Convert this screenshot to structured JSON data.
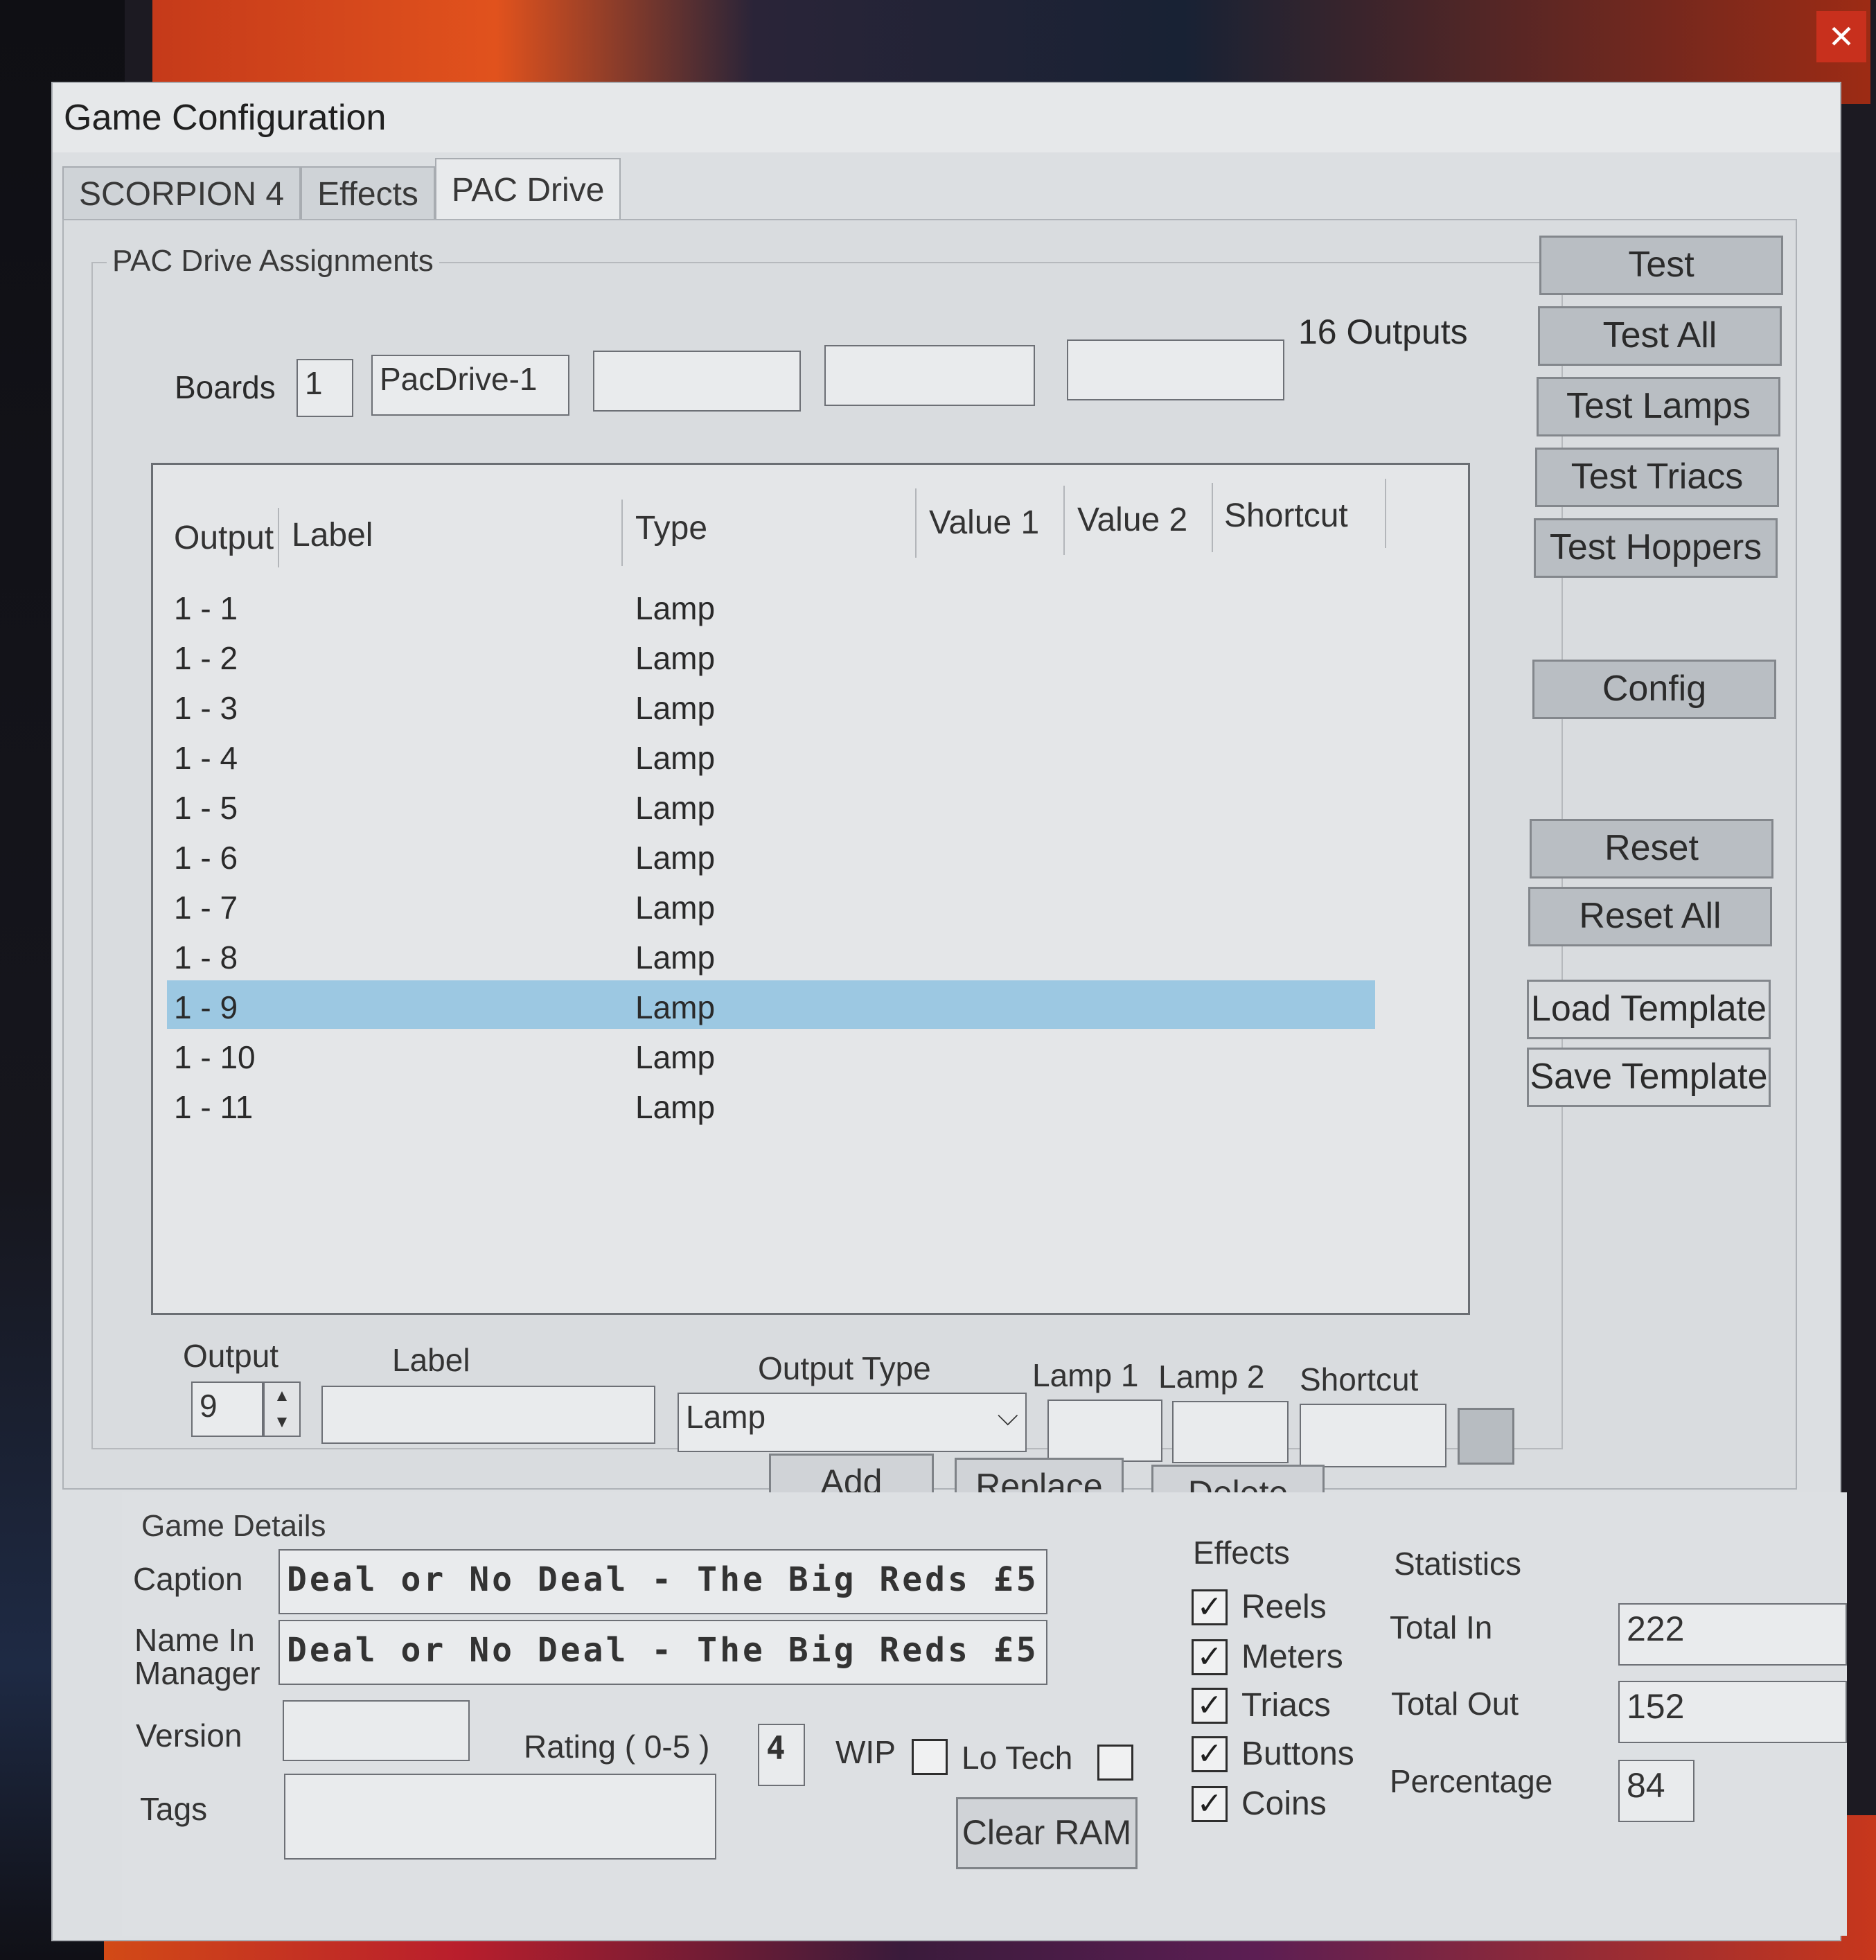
{
  "window": {
    "title": "Game Configuration",
    "close_glyph": "✕"
  },
  "tabs": [
    {
      "label": "SCORPION 4",
      "active": false
    },
    {
      "label": "Effects",
      "active": false
    },
    {
      "label": "PAC Drive",
      "active": true
    }
  ],
  "pac": {
    "group_label": "PAC Drive Assignments",
    "boards_label": "Boards",
    "boards_value": "1",
    "board_fields": [
      "PacDrive-1",
      "",
      "",
      ""
    ],
    "outputs_label": "16 Outputs",
    "columns": [
      "Output",
      "Label",
      "Type",
      "Value 1",
      "Value 2",
      "Shortcut"
    ],
    "rows": [
      {
        "output": "1 - 1",
        "label": "",
        "type": "Lamp"
      },
      {
        "output": "1 - 2",
        "label": "",
        "type": "Lamp"
      },
      {
        "output": "1 - 3",
        "label": "",
        "type": "Lamp"
      },
      {
        "output": "1 - 4",
        "label": "",
        "type": "Lamp"
      },
      {
        "output": "1 - 5",
        "label": "",
        "type": "Lamp"
      },
      {
        "output": "1 - 6",
        "label": "",
        "type": "Lamp"
      },
      {
        "output": "1 - 7",
        "label": "",
        "type": "Lamp"
      },
      {
        "output": "1 - 8",
        "label": "",
        "type": "Lamp"
      },
      {
        "output": "1 - 9",
        "label": "",
        "type": "Lamp",
        "selected": true
      },
      {
        "output": "1 - 10",
        "label": "",
        "type": "Lamp"
      },
      {
        "output": "1 - 11",
        "label": "",
        "type": "Lamp"
      }
    ],
    "edit": {
      "output_label": "Output",
      "output_value": "9",
      "label_label": "Label",
      "label_value": "",
      "output_type_label": "Output Type",
      "output_type_value": "Lamp",
      "lamp1_label": "Lamp 1",
      "lamp2_label": "Lamp 2",
      "shortcut_label": "Shortcut",
      "add": "Add",
      "replace": "Replace",
      "delete": "Delete"
    }
  },
  "side_buttons": {
    "test": "Test",
    "test_all": "Test All",
    "test_lamps": "Test Lamps",
    "test_triacs": "Test Triacs",
    "test_hoppers": "Test Hoppers",
    "config": "Config",
    "reset": "Reset",
    "reset_all": "Reset All",
    "load_template": "Load Template",
    "save_template": "Save Template"
  },
  "details": {
    "group_label": "Game Details",
    "caption_label": "Caption",
    "caption_value": "Deal or No Deal - The Big Reds £5",
    "name_label_1": "Name In",
    "name_label_2": "Manager",
    "name_value": "Deal or No Deal - The Big Reds £5",
    "version_label": "Version",
    "version_value": "",
    "rating_label": "Rating ( 0-5 )",
    "rating_value": "4",
    "wip_label": "WIP",
    "lotech_label": "Lo Tech",
    "tags_label": "Tags",
    "tags_value": "",
    "clear_ram": "Clear RAM"
  },
  "effects": {
    "label": "Effects",
    "items": [
      {
        "label": "Reels",
        "checked": true
      },
      {
        "label": "Meters",
        "checked": true
      },
      {
        "label": "Triacs",
        "checked": true
      },
      {
        "label": "Buttons",
        "checked": true
      },
      {
        "label": "Coins",
        "checked": true
      }
    ]
  },
  "statistics": {
    "label": "Statistics",
    "total_in_label": "Total In",
    "total_in": "222",
    "total_out_label": "Total Out",
    "total_out": "152",
    "percentage_label": "Percentage",
    "percentage": "84"
  },
  "check_glyph": "✓",
  "colors": {
    "selection": "#9cc8e2",
    "close_button": "#c8301d"
  }
}
